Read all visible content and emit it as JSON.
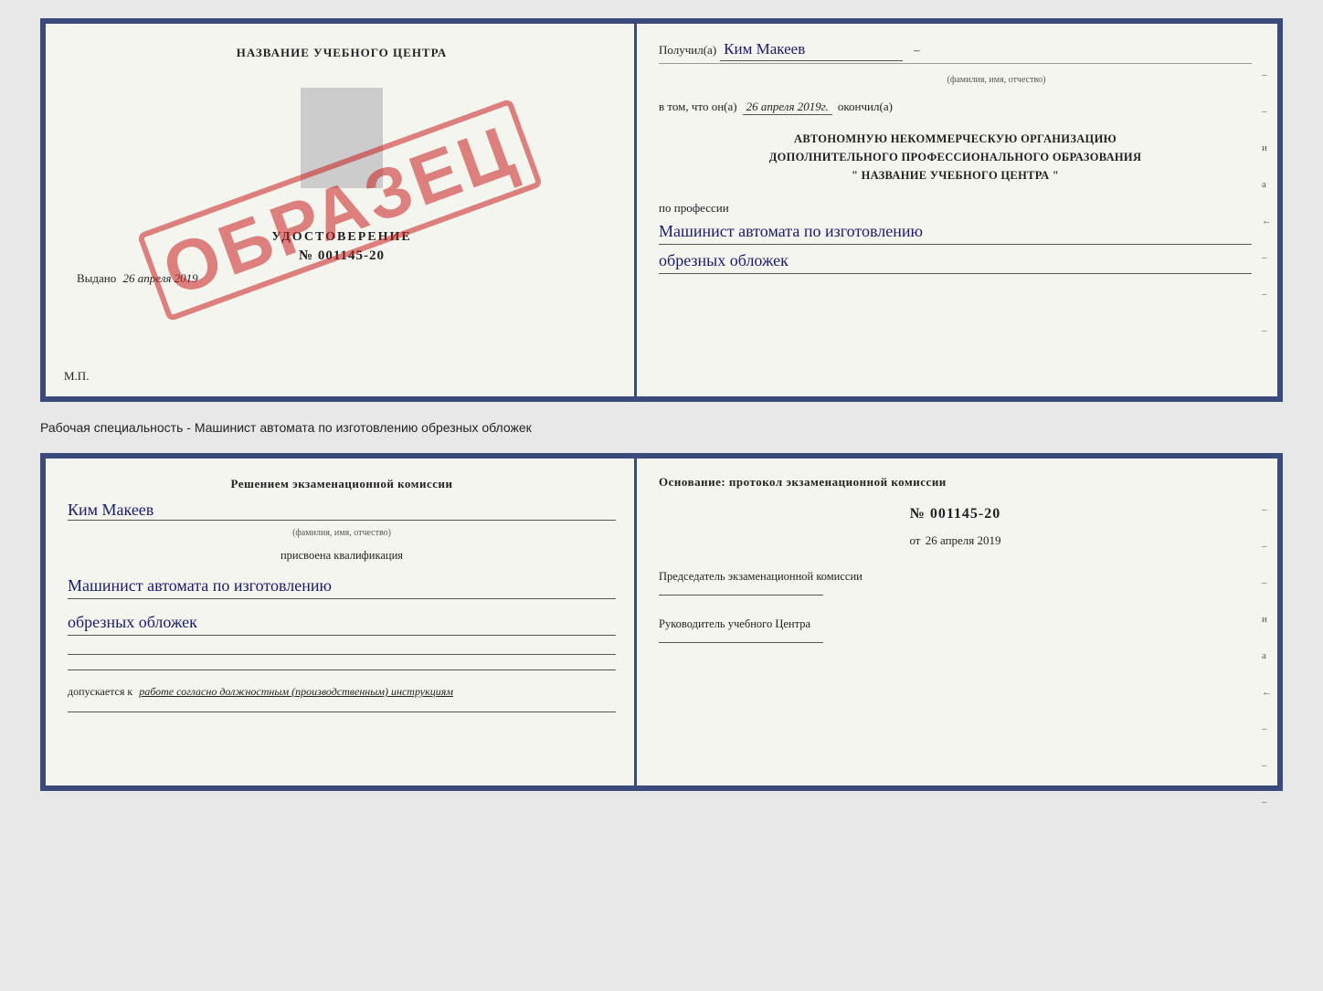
{
  "top_document": {
    "left": {
      "title": "НАЗВАНИЕ УЧЕБНОГО ЦЕНТРА",
      "cert_label": "УДОСТОВЕРЕНИЕ",
      "cert_number": "№ 001145-20",
      "issued_label": "Выдано",
      "issued_date": "26 апреля 2019",
      "mp_label": "М.П.",
      "stamp_text": "ОБРАЗЕЦ"
    },
    "right": {
      "received_label": "Получил(а)",
      "recipient_name": "Ким Макеев",
      "fio_hint": "(фамилия, имя, отчество)",
      "date_prefix": "в том, что он(а)",
      "date_value": "26 апреля 2019г.",
      "date_suffix": "окончил(а)",
      "org_line1": "АВТОНОМНУЮ НЕКОММЕРЧЕСКУЮ ОРГАНИЗАЦИЮ",
      "org_line2": "ДОПОЛНИТЕЛЬНОГО ПРОФЕССИОНАЛЬНОГО ОБРАЗОВАНИЯ",
      "org_line3": "\"  НАЗВАНИЕ УЧЕБНОГО ЦЕНТРА  \"",
      "profession_label": "по профессии",
      "profession_line1": "Машинист автомата по изготовлению",
      "profession_line2": "обрезных обложек",
      "side_marks": [
        "–",
        "–",
        "и",
        "а",
        "←",
        "–",
        "–",
        "–",
        "–",
        "–"
      ]
    }
  },
  "middle_text": "Рабочая специальность - Машинист автомата по изготовлению обрезных обложек",
  "bottom_document": {
    "left": {
      "commission_heading": "Решением экзаменационной комиссии",
      "commission_name": "Ким Макеев",
      "fio_hint": "(фамилия, имя, отчество)",
      "qual_label": "присвоена квалификация",
      "qual_line1": "Машинист автомата по изготовлению",
      "qual_line2": "обрезных обложек",
      "allowed_prefix": "допускается к",
      "allowed_text": "работе согласно должностным (производственным) инструкциям"
    },
    "right": {
      "basis_label": "Основание: протокол экзаменационной комиссии",
      "protocol_number": "№ 001145-20",
      "protocol_date_prefix": "от",
      "protocol_date": "26 апреля 2019",
      "chair_label": "Председатель экзаменационной комиссии",
      "director_label": "Руководитель учебного Центра",
      "side_marks": [
        "–",
        "–",
        "–",
        "и",
        "а",
        "←",
        "–",
        "–",
        "–",
        "–"
      ]
    }
  }
}
